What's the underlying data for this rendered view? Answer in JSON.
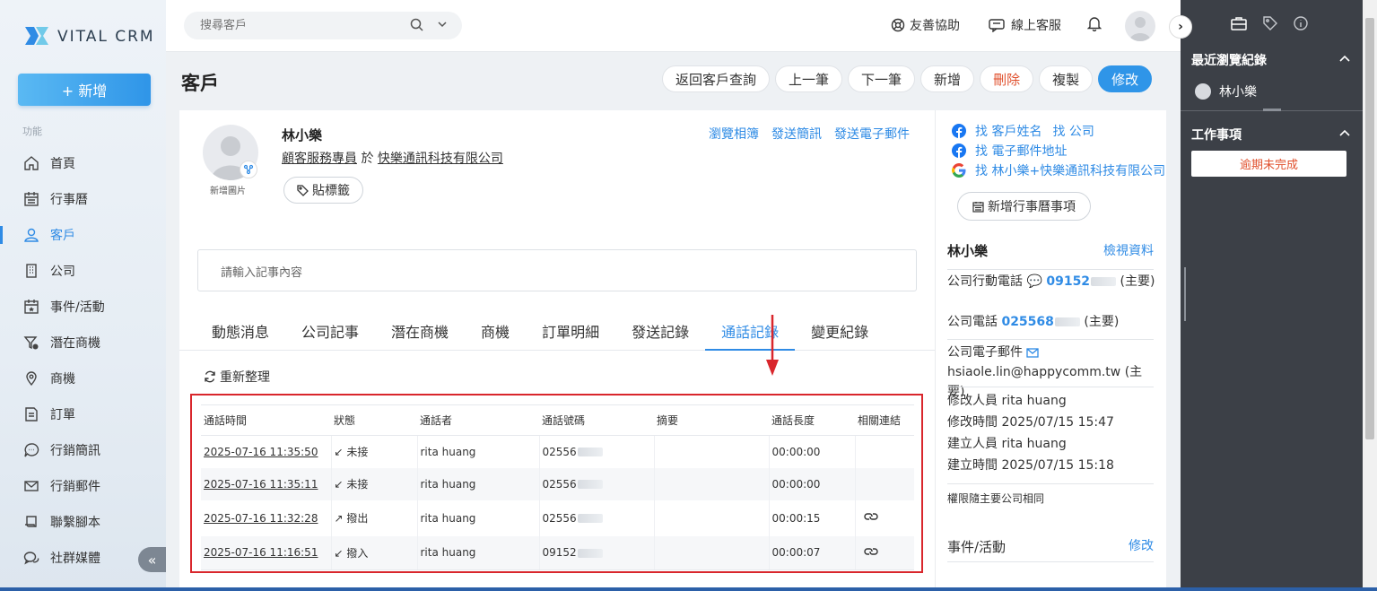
{
  "brand": {
    "name": "VITAL CRM"
  },
  "sidebar": {
    "new_label": "+ 新增",
    "section_label": "功能",
    "items": [
      {
        "label": "首頁",
        "icon": "home-icon"
      },
      {
        "label": "行事曆",
        "icon": "calendar-icon"
      },
      {
        "label": "客戶",
        "icon": "customer-icon",
        "active": true
      },
      {
        "label": "公司",
        "icon": "building-icon"
      },
      {
        "label": "事件/活動",
        "icon": "event-icon"
      },
      {
        "label": "潛在商機",
        "icon": "funnel-icon"
      },
      {
        "label": "商機",
        "icon": "opportunity-icon"
      },
      {
        "label": "訂單",
        "icon": "order-icon"
      },
      {
        "label": "行銷簡訊",
        "icon": "sms-icon"
      },
      {
        "label": "行銷郵件",
        "icon": "mail-icon"
      },
      {
        "label": "聯繫腳本",
        "icon": "script-icon"
      },
      {
        "label": "社群媒體",
        "icon": "social-icon"
      }
    ]
  },
  "topbar": {
    "search_placeholder": "搜尋客戶",
    "help_label": "友善協助",
    "support_label": "線上客服"
  },
  "page": {
    "title": "客戶",
    "actions": [
      "返回客戶查詢",
      "上一筆",
      "下一筆",
      "新增",
      "刪除",
      "複製",
      "修改"
    ]
  },
  "customer": {
    "name": "林小樂",
    "title": "顧客服務專員",
    "at": "於",
    "company": "快樂通訊科技有限公司",
    "add_photo": "新增圖片",
    "tag_label": "貼標籤",
    "links": [
      "瀏覽相簿",
      "發送簡訊",
      "發送電子郵件"
    ],
    "note_placeholder": "請輸入記事內容"
  },
  "tabs": [
    "動態消息",
    "公司記事",
    "潛在商機",
    "商機",
    "訂單明細",
    "發送記錄",
    "通話記錄",
    "變更紀錄"
  ],
  "active_tab": "通話記錄",
  "call_log": {
    "refresh_label": "重新整理",
    "columns": [
      "通話時間",
      "狀態",
      "通話者",
      "通話號碼",
      "摘要",
      "通話長度",
      "相關連結"
    ],
    "rows": [
      {
        "time": "2025-07-16 11:35:50",
        "status": "未接",
        "status_type": "missed",
        "caller": "rita huang",
        "number": "02556",
        "summary": "",
        "duration": "00:00:00",
        "link": false
      },
      {
        "time": "2025-07-16 11:35:11",
        "status": "未接",
        "status_type": "missed",
        "caller": "rita huang",
        "number": "02556",
        "summary": "",
        "duration": "00:00:00",
        "link": false
      },
      {
        "time": "2025-07-16 11:32:28",
        "status": "撥出",
        "status_type": "outgoing",
        "caller": "rita huang",
        "number": "02556",
        "summary": "",
        "duration": "00:00:15",
        "link": true
      },
      {
        "time": "2025-07-16 11:16:51",
        "status": "撥入",
        "status_type": "incoming",
        "caller": "rita huang",
        "number": "09152",
        "summary": "",
        "duration": "00:00:07",
        "link": true
      }
    ]
  },
  "detail_panel": {
    "search_links": [
      {
        "parts": [
          "找 客戶姓名",
          "找 公司"
        ],
        "icon": "facebook-icon"
      },
      {
        "parts": [
          "找 電子郵件地址"
        ],
        "icon": "facebook-icon"
      },
      {
        "parts": [
          "找 林小樂+快樂通訊科技有限公司"
        ],
        "icon": "google-icon"
      }
    ],
    "add_calendar_label": "新增行事曆事項",
    "name": "林小樂",
    "view_label": "檢視資料",
    "company_mobile_label": "公司行動電話",
    "company_mobile": "09152",
    "company_mobile_tag": "(主要)",
    "company_phone_label": "公司電話",
    "company_phone": "025568",
    "company_phone_tag": "(主要)",
    "company_email_label": "公司電子郵件",
    "company_email": "hsiaole.lin@happycomm.tw",
    "company_email_tag": "(主要)",
    "modified_by_label": "修改人員",
    "modified_by": "rita huang",
    "modified_time_label": "修改時間",
    "modified_time": "2025/07/15 15:47",
    "created_by_label": "建立人員",
    "created_by": "rita huang",
    "created_time_label": "建立時間",
    "created_time": "2025/07/15 15:18",
    "permission_note": "權限隨主要公司相同",
    "events_label": "事件/活動",
    "events_edit": "修改"
  },
  "right_panel": {
    "recent_label": "最近瀏覽紀錄",
    "recent_user": "林小樂",
    "tasks_label": "工作事項",
    "overdue_label": "逾期未完成"
  },
  "colors": {
    "accent": "#2f8be5",
    "danger": "#e0502d",
    "highlight_frame": "#d9262c",
    "panel_dark": "#3c4047"
  }
}
